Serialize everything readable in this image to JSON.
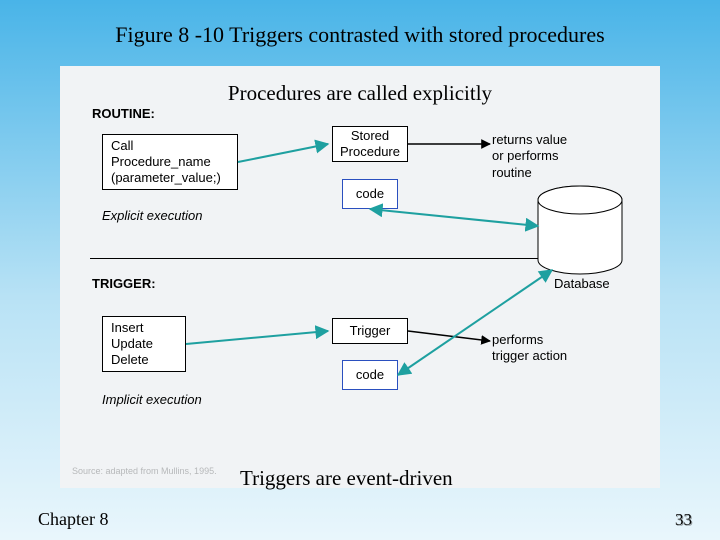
{
  "title": "Figure 8 -10 Triggers contrasted with stored procedures",
  "subtitle_top": "Procedures are called explicitly",
  "subtitle_bottom": "Triggers are event-driven",
  "footer": {
    "chapter": "Chapter 8",
    "page": "33"
  },
  "routine": {
    "heading": "ROUTINE:",
    "call_lines": [
      "Call",
      "Procedure_name",
      "(parameter_value;)"
    ],
    "exec_label": "Explicit execution",
    "stored_proc": "Stored\nProcedure",
    "code": "code",
    "returns": "returns value\nor performs\nroutine"
  },
  "trigger": {
    "heading": "TRIGGER:",
    "ops_lines": [
      "Insert",
      "Update",
      "Delete"
    ],
    "exec_label": "Implicit execution",
    "trigger_box": "Trigger",
    "code": "code",
    "performs": "performs\ntrigger action"
  },
  "db_label": "Database",
  "source_note": "Source: adapted from Mullins, 1995."
}
